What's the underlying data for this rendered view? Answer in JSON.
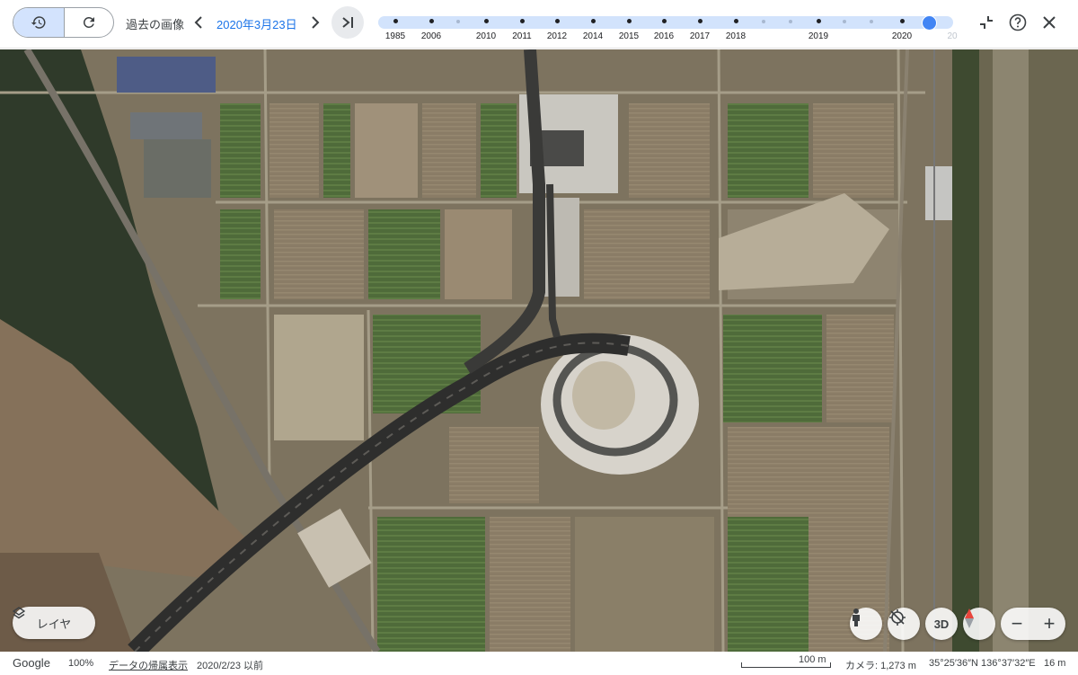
{
  "toolbar": {
    "history_label": "過去の画像",
    "selected_date": "2020年3月23日",
    "prev_icon": "chevron-left-icon",
    "next_icon": "chevron-right-icon",
    "latest_icon": "skip-to-latest-icon",
    "history_icon": "history-icon",
    "redo_icon": "rotate-icon"
  },
  "timeline": {
    "years": [
      "1985",
      "2006",
      "2010",
      "2011",
      "2012",
      "2014",
      "2015",
      "2016",
      "2017",
      "2018",
      "2019",
      "2020"
    ],
    "cut_off_label": "20",
    "selected_year": "2020",
    "accent_color": "#4285f4",
    "track_color": "#d2e3fc"
  },
  "window_controls": {
    "collapse_icon": "collapse-icon",
    "help_icon": "help-icon",
    "close_icon": "close-icon"
  },
  "map": {
    "layers_label": "レイヤ",
    "layers_icon": "layers-icon",
    "pegman_icon": "pegman-icon",
    "tilt_icon": "tilt-off-icon",
    "view_3d_label": "3D",
    "compass_icon": "compass-icon",
    "zoom_out_label": "−",
    "zoom_in_label": "+"
  },
  "status": {
    "brand": "Google",
    "zoom": "100%",
    "attribution_link": "データの帰属表示",
    "imagery_date": "2020/2/23 以前",
    "scale": "100 m",
    "camera": "カメラ: 1,273 m",
    "coords": "35°25′36″N 136°37′32″E",
    "altitude": "16 m"
  }
}
